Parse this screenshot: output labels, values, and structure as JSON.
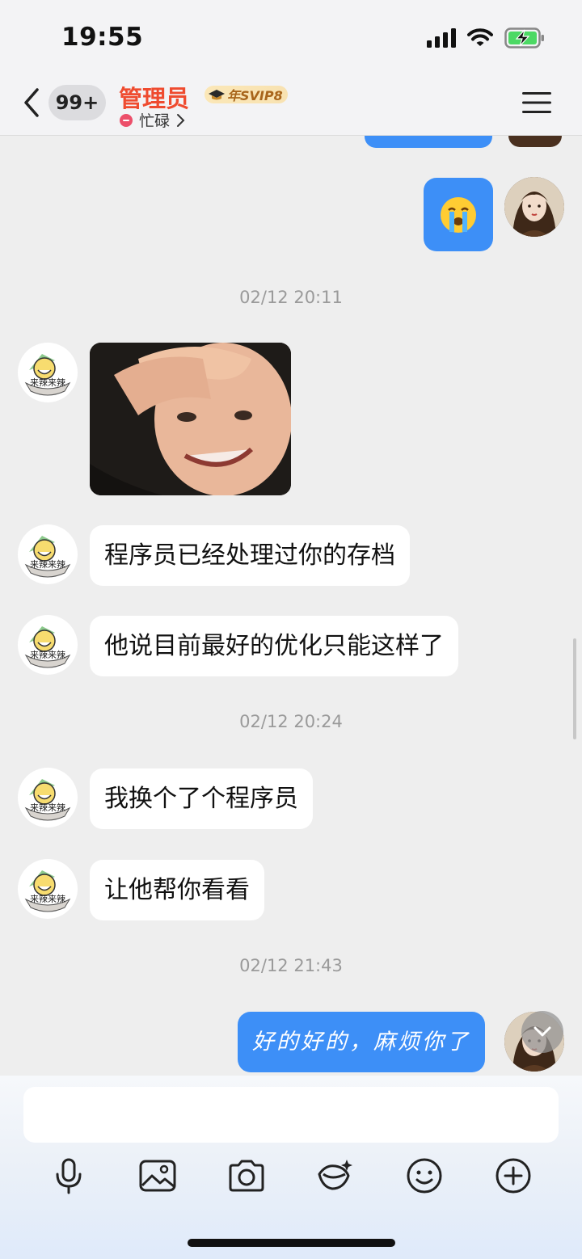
{
  "status_bar": {
    "time": "19:55"
  },
  "header": {
    "unread_count": "99+",
    "contact_name": "管理员",
    "vip_badge": "年SVIP8",
    "presence": "忙碌",
    "accent_color": "#ef4b2f"
  },
  "messages": [
    {
      "type": "timestamp",
      "text": "02/12 20:11"
    },
    {
      "type": "incoming",
      "text": "程序员已经处理过你的存档"
    },
    {
      "type": "incoming",
      "text": "他说目前最好的优化只能这样了"
    },
    {
      "type": "timestamp",
      "text": "02/12 20:24"
    },
    {
      "type": "incoming",
      "text": "我换个了个程序员"
    },
    {
      "type": "incoming",
      "text": "让他帮你看看"
    },
    {
      "type": "timestamp",
      "text": "02/12 21:43"
    },
    {
      "type": "outgoing",
      "text": "好的好的，麻烦你了"
    }
  ],
  "sticker_caption": "来辣来辣",
  "composer": {
    "placeholder": "",
    "tools": [
      "microphone-icon",
      "image-icon",
      "camera-icon",
      "red-packet-icon",
      "emoji-icon",
      "plus-icon"
    ]
  },
  "colors": {
    "outgoing_bubble": "#3d8ff7",
    "incoming_bubble": "#ffffff",
    "background": "#eeeeee"
  }
}
